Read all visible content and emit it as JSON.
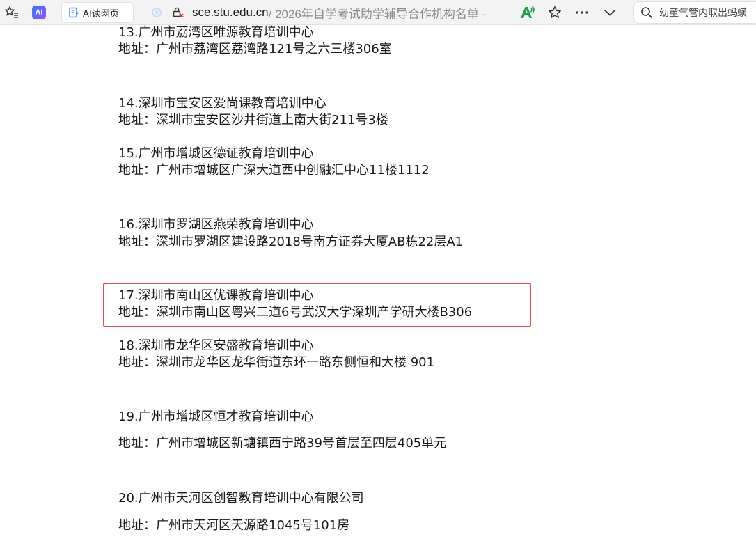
{
  "toolbar": {
    "ai_read_label": "AI读网页",
    "url_domain": "sce.stu.edu.cn",
    "url_rest": " / 2026年自学考试助学辅导合作机构名单 -",
    "search_text": "幼童气管内取出蚂蟥",
    "accent_color": "#2f7bff",
    "read_aloud_color": "#1fa34a"
  },
  "entries": [
    {
      "name": "13.广州市荔湾区唯源教育培训中心",
      "address": "地址：广州市荔湾区荔湾路121号之六三楼306室"
    },
    {
      "name": "14.深圳市宝安区爱尚课教育培训中心",
      "address": "地址：深圳市宝安区沙井街道上南大街211号3楼"
    },
    {
      "name": "15.广州市增城区德证教育培训中心",
      "address": "地址：广州市增城区广深大道西中创融汇中心11楼1112"
    },
    {
      "name": "16.深圳市罗湖区燕荣教育培训中心",
      "address": "地址：深圳市罗湖区建设路2018号南方证券大厦AB栋22层A1"
    },
    {
      "name": "17.深圳市南山区优课教育培训中心",
      "address": "地址：深圳市南山区粤兴二道6号武汉大学深圳产学研大楼B306"
    },
    {
      "name": "18.深圳市龙华区安盛教育培训中心",
      "address": "地址：深圳市龙华区龙华街道东环一路东侧恒和大楼 901"
    },
    {
      "name": "19.广州市增城区恒才教育培训中心",
      "address": "地址：广州市增城区新塘镇西宁路39号首层至四层405单元"
    },
    {
      "name": "20.广州市天河区创智教育培训中心有限公司",
      "address": "地址：广州市天河区天源路1045号101房"
    }
  ],
  "highlight_color": "#e2504c"
}
